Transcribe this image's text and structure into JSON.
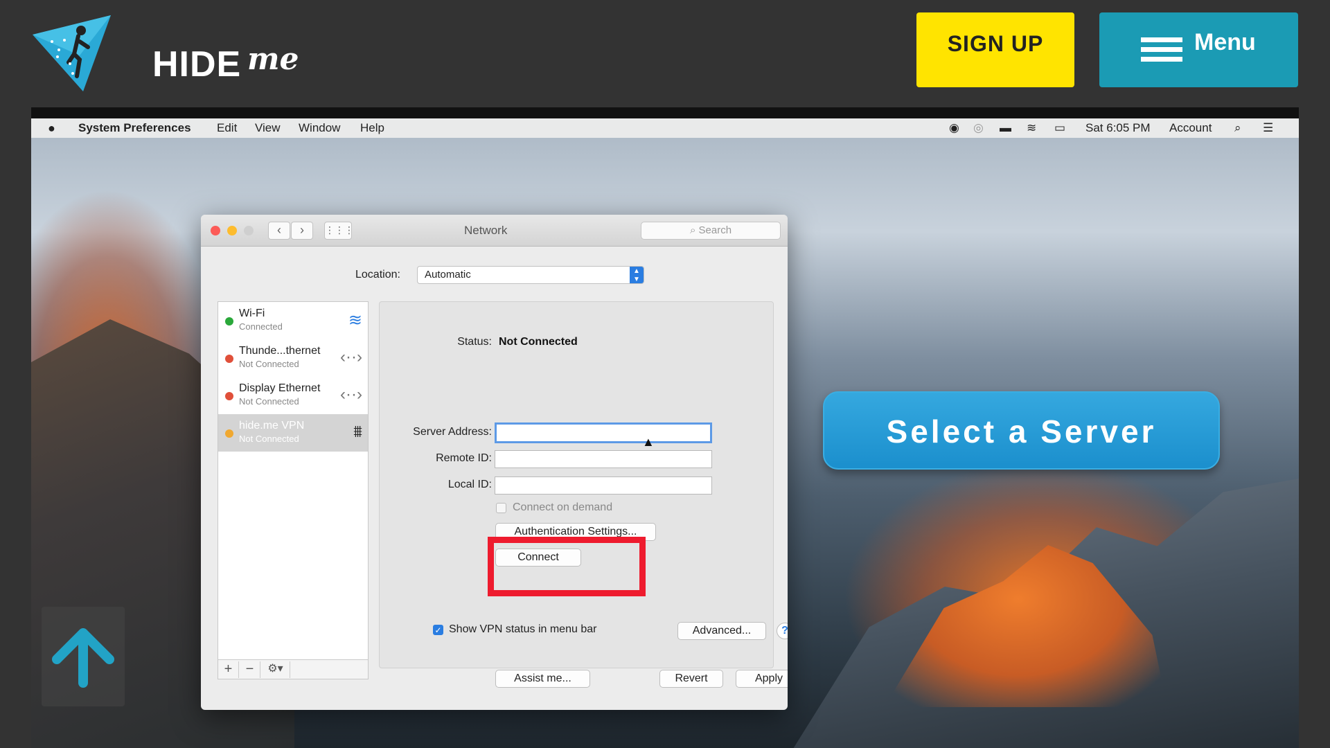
{
  "header": {
    "logo_text": "HIDE",
    "logo_me": "me",
    "signup_label": "SIGN UP",
    "menu_label": "Menu"
  },
  "mac_menubar": {
    "app_name": "System Preferences",
    "menus": [
      "Edit",
      "View",
      "Window",
      "Help"
    ],
    "clock": "Sat 6:05 PM",
    "account": "Account"
  },
  "window": {
    "title": "Network",
    "search_placeholder": "Search",
    "location_label": "Location:",
    "location_value": "Automatic",
    "services": [
      {
        "name": "Wi-Fi",
        "status": "Connected",
        "dot_color": "#2aa83a"
      },
      {
        "name": "Thunde...thernet",
        "status": "Not Connected",
        "dot_color": "#e0503a"
      },
      {
        "name": "Display Ethernet",
        "status": "Not Connected",
        "dot_color": "#e0503a"
      },
      {
        "name": "hide.me VPN",
        "status": "Not Connected",
        "dot_color": "#f0a830"
      }
    ],
    "status_label": "Status:",
    "status_value": "Not Connected",
    "server_address_label": "Server Address:",
    "remote_id_label": "Remote ID:",
    "local_id_label": "Local ID:",
    "connect_on_demand_label": "Connect on demand",
    "auth_settings_label": "Authentication Settings...",
    "connect_label": "Connect",
    "show_vpn_status_label": "Show VPN status in menu bar",
    "advanced_label": "Advanced...",
    "help_label": "?",
    "assist_label": "Assist me...",
    "revert_label": "Revert",
    "apply_label": "Apply"
  },
  "overlay": {
    "select_server_label": "Select a Server"
  },
  "colors": {
    "header_bg": "#333333",
    "signup_bg": "#ffe400",
    "menu_bg": "#1b9bb4",
    "highlight_red": "#ee1b2e",
    "callout_blue": "#1b8fcd"
  }
}
